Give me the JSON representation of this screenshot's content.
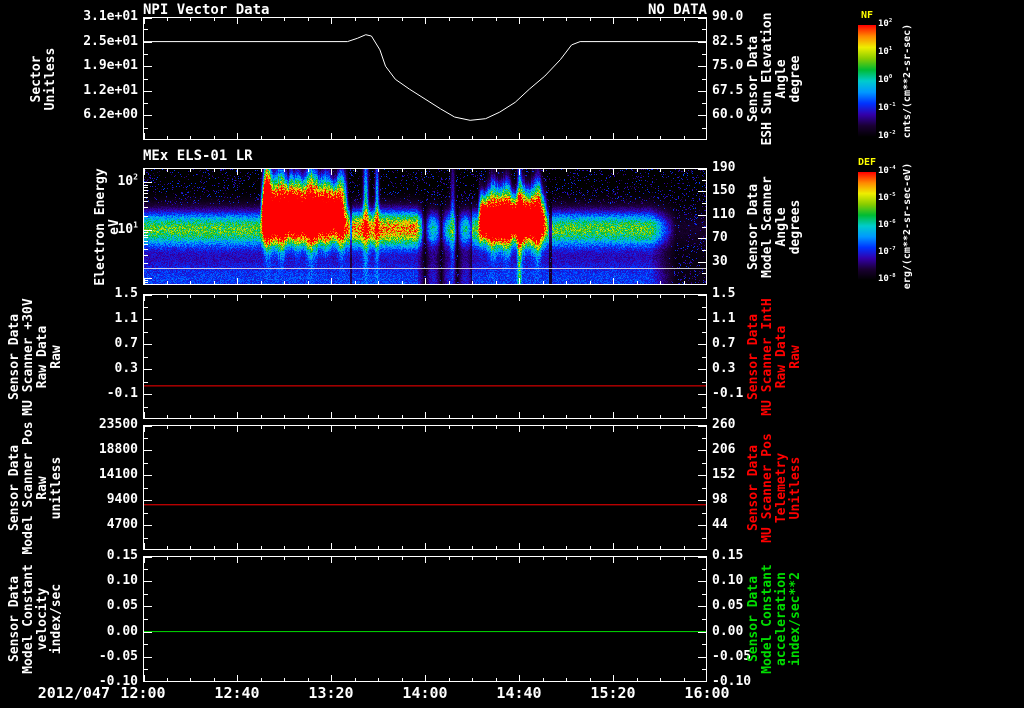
{
  "app": {
    "background": "#000000",
    "text_color": "#ffffff",
    "accent_red": "#ff0000",
    "accent_green": "#00dd00",
    "accent_yellow": "#ffff00"
  },
  "x_axis": {
    "date_label": "2012/047",
    "tick_labels": [
      "12:00",
      "12:40",
      "13:20",
      "14:00",
      "14:40",
      "15:20",
      "16:00"
    ],
    "t_start": 12.0,
    "t_end": 16.0
  },
  "colormap": [
    "#000000",
    "#1a0033",
    "#3300aa",
    "#0033ff",
    "#0099ff",
    "#00cccc",
    "#00bb33",
    "#88cc00",
    "#eeee00",
    "#ff8800",
    "#ff0000"
  ],
  "chart_data": [
    {
      "id": "npi",
      "type": "line",
      "title": "NPI Vector Data",
      "annotation": "NO DATA",
      "left_axis": {
        "label_lines": [
          "Sector",
          "Unitless"
        ],
        "tick_labels": [
          "3.1e+01",
          "2.5e+01",
          "1.9e+01",
          "1.2e+01",
          "6.2e+00"
        ],
        "color": "#ffffff"
      },
      "right_axis": {
        "label_lines": [
          "Sensor Data",
          "ESH Sun Elevation",
          "Angle",
          "degree"
        ],
        "tick_labels": [
          "90.0",
          "82.5",
          "75.0",
          "67.5",
          "60.0"
        ],
        "color": "#ffffff",
        "tick_color": "#ffffff"
      },
      "y_top": 90.0,
      "y_bottom": 52.5,
      "series": [
        {
          "name": "esh_sun_elevation_angle",
          "color": "#ffffff",
          "x": [
            12.0,
            13.45,
            13.52,
            13.58,
            13.62,
            13.68,
            13.72,
            13.79,
            13.89,
            14.0,
            14.11,
            14.21,
            14.32,
            14.43,
            14.53,
            14.64,
            14.74,
            14.85,
            14.96,
            15.04,
            15.1,
            16.0
          ],
          "y": [
            82.5,
            82.5,
            83.5,
            84.6,
            84.2,
            80.0,
            75.0,
            71.0,
            68.0,
            65.0,
            62.0,
            59.5,
            58.5,
            59.0,
            61.0,
            64.0,
            68.0,
            72.0,
            77.0,
            81.5,
            82.5,
            82.5
          ]
        }
      ]
    },
    {
      "id": "els",
      "type": "heatmap",
      "title": "MEx ELS-01 LR",
      "left_axis": {
        "label_lines": [
          "Electron Energy",
          "eV"
        ],
        "scale": "log",
        "tick_labels": [
          "10^2",
          "10^1"
        ],
        "tick_log_values": [
          2,
          1
        ],
        "log_top": 2.3,
        "log_bottom": -0.15,
        "color": "#ffffff"
      },
      "right_axis": {
        "label_lines": [
          "Sensor Data",
          "Model Scanner",
          "Angle",
          "degrees"
        ],
        "tick_labels": [
          "190",
          "150",
          "110",
          "70",
          "30"
        ],
        "color": "#ffffff",
        "tick_color": "#ffffff"
      },
      "features": {
        "noise_seed": 7,
        "band": {
          "center_log_ev": 1.02,
          "sigma_log": 0.26,
          "amplitude": 0.62
        },
        "low_fill": {
          "center_log_ev": -0.05,
          "sigma_log": 0.45,
          "amplitude": 0.3
        },
        "band_boost": {
          "t_start": 13.45,
          "t_end": 13.98,
          "amplitude": 0.25
        },
        "blobs": [
          {
            "t_start": 12.83,
            "t_end": 13.46,
            "center_log_ev": 1.45,
            "sigma_log": 0.52,
            "amplitude": 1.35
          },
          {
            "t_start": 14.375,
            "t_end": 14.87,
            "center_log_ev": 1.3,
            "sigma_log": 0.45,
            "amplitude": 1.25
          }
        ],
        "streaks": [
          {
            "t": 12.88,
            "w": 0.015,
            "c": 1.8,
            "s": 0.5,
            "a": 0.6
          },
          {
            "t": 13.05,
            "w": 0.01,
            "c": 1.7,
            "s": 0.5,
            "a": 0.4
          },
          {
            "t": 13.58,
            "w": 0.013,
            "c": 1.6,
            "s": 0.8,
            "a": 0.5
          },
          {
            "t": 13.66,
            "w": 0.01,
            "c": 1.55,
            "s": 0.75,
            "a": 0.45
          },
          {
            "t": 14.2,
            "w": 0.012,
            "c": 1.3,
            "s": 0.9,
            "a": 0.4
          },
          {
            "t": 14.67,
            "w": 0.01,
            "c": 1.1,
            "s": 1.2,
            "a": 0.5
          }
        ],
        "gaps": {
          "t_start": 13.95,
          "t_end": 14.33,
          "phase": 14.0,
          "period": 0.115,
          "min_factor": 0.07
        },
        "notches": [
          {
            "t": 13.475,
            "width": 0.008,
            "factor": 0.45
          },
          {
            "t": 14.89,
            "width": 0.01,
            "factor": 0.3
          }
        ],
        "fade": {
          "t_start": 15.6,
          "t_end": 15.78,
          "min_factor": 0.12
        },
        "baseline_log_ev": 0.2
      }
    },
    {
      "id": "mu_scanner_30v",
      "type": "line",
      "left_axis": {
        "label_lines": [
          "Sensor Data",
          "MU Scanner +30V",
          "Raw Data",
          "Raw"
        ],
        "tick_labels": [
          "1.5",
          "1.1",
          "0.7",
          "0.3",
          "-0.1"
        ],
        "color": "#ffffff"
      },
      "right_axis": {
        "label_lines": [
          "Sensor Data",
          "MU Scanner IntH",
          "Raw Data",
          "Raw"
        ],
        "tick_labels": [
          "1.5",
          "1.1",
          "0.7",
          "0.3",
          "-0.1"
        ],
        "color": "#ff0000",
        "tick_color": "#ffffff"
      },
      "y_top": 1.5,
      "y_bottom": -0.5,
      "series": [
        {
          "name": "mu_scanner_inth_raw",
          "color": "#ff0000",
          "x": [
            12.0,
            16.0
          ],
          "y": [
            0.03,
            0.03
          ]
        }
      ]
    },
    {
      "id": "model_scanner_pos",
      "type": "line",
      "left_axis": {
        "label_lines": [
          "Sensor Data",
          "Model Scanner Pos",
          "Raw",
          "unitless"
        ],
        "tick_labels": [
          "23500",
          "18800",
          "14100",
          "9400",
          "4700"
        ],
        "color": "#ffffff"
      },
      "right_axis": {
        "label_lines": [
          "Sensor Data",
          "MU Scanner Pos",
          "Telemetry",
          "Unitless"
        ],
        "tick_labels": [
          "260",
          "206",
          "152",
          "98",
          "44"
        ],
        "color": "#ff0000",
        "tick_color": "#ffffff"
      },
      "y_top": 23500,
      "y_bottom": 0,
      "series": [
        {
          "name": "mu_scanner_pos_telemetry",
          "color": "#ff0000",
          "x": [
            12.0,
            16.0
          ],
          "y": [
            8500,
            8500
          ]
        }
      ]
    },
    {
      "id": "model_constant",
      "type": "line",
      "left_axis": {
        "label_lines": [
          "Sensor Data",
          "Model Constant",
          "velocity",
          "index/sec"
        ],
        "tick_labels": [
          "0.15",
          "0.10",
          "0.05",
          "0.00",
          "-0.05",
          "-0.10"
        ],
        "color": "#ffffff"
      },
      "right_axis": {
        "label_lines": [
          "Sensor Data",
          "Model Constant",
          "acceleration",
          "index/sec**2"
        ],
        "tick_labels": [
          "0.15",
          "0.10",
          "0.05",
          "0.00",
          "-0.05",
          "-0.10"
        ],
        "color": "#00dd00",
        "tick_color": "#ffffff"
      },
      "y_top": 0.15,
      "y_bottom": -0.1,
      "series": [
        {
          "name": "model_constant_velocity",
          "color": "#00dd00",
          "x": [
            12.0,
            16.0
          ],
          "y": [
            0.0,
            0.0
          ]
        }
      ]
    }
  ],
  "colorbars": [
    {
      "id": "nf",
      "title": "NF",
      "tick_labels": [
        "10^2",
        "10^1",
        "10^0",
        "10^-1",
        "10^-2"
      ],
      "unit": "cnts/(cm**2-sr-sec)"
    },
    {
      "id": "def",
      "title": "DEF",
      "tick_labels": [
        "10^-4",
        "10^-5",
        "10^-6",
        "10^-7",
        "10^-8"
      ],
      "unit": "erg/(cm**2-sr-sec-eV)"
    }
  ]
}
